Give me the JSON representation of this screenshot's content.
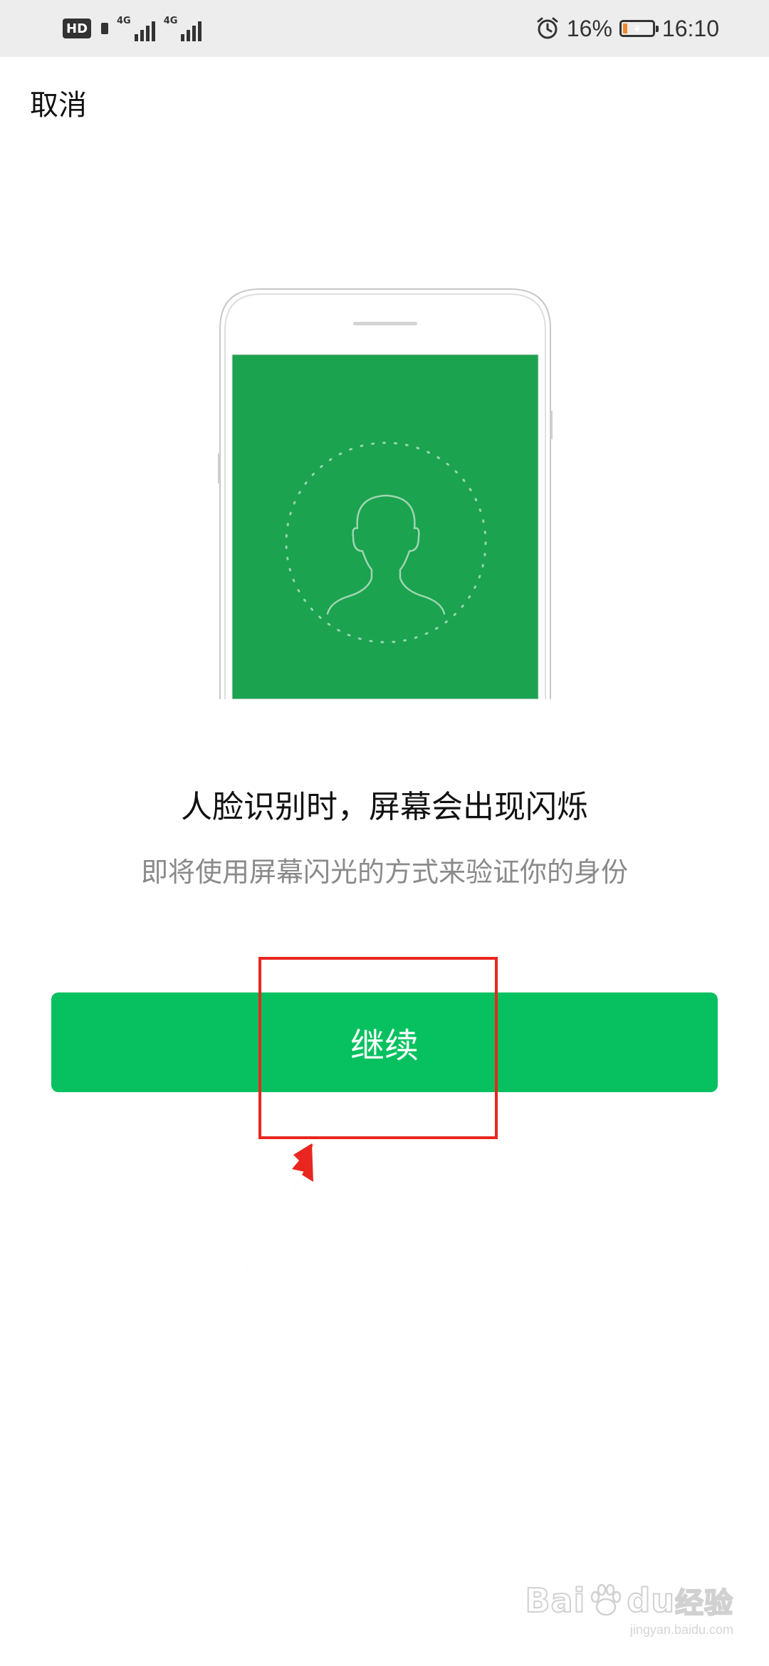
{
  "status_bar": {
    "hd_label": "HD",
    "network_1": "4G",
    "network_2": "4G",
    "battery_percent": "16%",
    "battery_level": 0.16,
    "time": "16:10",
    "icons": [
      "hd-icon",
      "signal-icon",
      "signal-icon",
      "alarm-icon",
      "battery-icon"
    ]
  },
  "nav": {
    "cancel_label": "取消"
  },
  "illustration": {
    "icon": "face-recognition-phone-illustration",
    "screen_color": "#1ba350"
  },
  "main": {
    "headline": "人脸识别时，屏幕会出现闪烁",
    "subline": "即将使用屏幕闪光的方式来验证你的身份",
    "continue_label": "继续"
  },
  "annotation": {
    "color": "#e8261f",
    "shapes": [
      "highlight-rectangle",
      "pointer-arrow"
    ]
  },
  "watermark": {
    "logo_text_1": "Bai",
    "logo_text_2": "du",
    "logo_text_3": "经验",
    "sub_text": "jingyan.baidu.com"
  },
  "colors": {
    "accent": "#07c160",
    "status_bar_bg": "#ededed"
  }
}
